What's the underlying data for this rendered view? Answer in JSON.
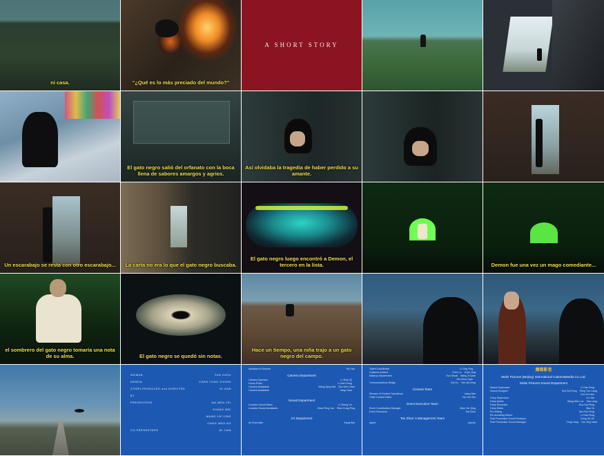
{
  "title_card": "A SHORT STORY",
  "subtitles": {
    "f1": "ni casa.",
    "f2": "“¿Qué es lo más preciado del mundo?”",
    "f7": "El gato negro salió del orfanato con la boca llena de sabores amargos y agrios.",
    "f8": "Así olvidaba la tragedia de haber perdido a su amante.",
    "f11": "Un escarabajo se resta con otro escarabajo...",
    "f12": "La carta no era lo que el gato negro buscaba.",
    "f13": "El gato negro luego encontró a Demon, el tercero en la lista.",
    "f15": "Demon fue una vez un mago comediante...",
    "f16": "el sombrero del gato negro tomaría una nota de su alma.",
    "f17": "El gato negro se quedó sin notas.",
    "f18": "Hace un tiempo, una niña trajo a un gato negro del campo."
  },
  "credits1": [
    [
      "WOMAN",
      "YAN ZHOU"
    ],
    [
      "DEMON",
      "CHEN YONG ZHONG"
    ],
    [
      "STORY,PRODUCED and DIRECTED BY",
      "BI GAN"
    ],
    [
      "PRESENTERS",
      "MA WEN YEI"
    ],
    [
      "",
      "ZHANG WEI"
    ],
    [
      "",
      "WANG JIE XING"
    ],
    [
      "",
      "JIANG WEN BO"
    ],
    [
      "CO-PRESENTERS",
      "BI JIAN"
    ]
  ],
  "credits2": {
    "top": [
      "Assistant to Director",
      "Wu Yao"
    ],
    "camera_heading": "Camera Department",
    "camera": [
      [
        "Camera Operator",
        "Li Zhao Qi",
        ""
      ],
      [
        "Focus Puller",
        "Li Wen Peng",
        ""
      ],
      [
        "Camera Assistants",
        "Wang Qing Wei",
        "Zhu Wen Zhan"
      ],
      [
        "Camera Assistants",
        "Yang Chao",
        ""
      ]
    ],
    "sound_heading": "Sound Department",
    "sound": [
      [
        "Location Sound Mixer",
        "Li Zheng Lin",
        ""
      ],
      [
        "Location Sound Assistants",
        "Zhao Peng Jun",
        "Shen Kang Ping"
      ]
    ],
    "art_heading": "Art Department",
    "art": [
      [
        "Art Executive",
        "Kang Wei"
      ]
    ]
  },
  "credits3": {
    "top": [
      [
        "Talent Coordinator",
        "Li Ying Ying",
        ""
      ],
      [
        "Costume Advisor",
        "Chen Lu",
        "Guan Jing"
      ],
      [
        "Makeup Department",
        "Sun Shuai",
        "Wang Xi Qian"
      ],
      [
        "",
        "Ma Shuo Yuan",
        ""
      ],
      [
        "Communications Bridge",
        "Cai Xu",
        "Yan Jia Dong"
      ]
    ],
    "content_heading": "Content Team",
    "content": [
      [
        "Director of Content Operations",
        "Liang Nan"
      ],
      [
        "Chief Content Editor",
        "Yao Xin Zhu"
      ]
    ],
    "event_heading": "Event Execution Team",
    "event": [
      [
        "Event Coordination Manager",
        "Miao Xin Qing"
      ],
      [
        "Event Execution",
        "Ma Zhuo"
      ]
    ],
    "mgmt_heading": "Tan Zhuo’ s Management Team",
    "mgmt": [
      [
        "Agent",
        "Jasmin"
      ]
    ]
  },
  "credits4": {
    "logo": "魔都影音",
    "company": "Mofei Pictures (Beijing) International Culture&Media Co.,Ltd.",
    "dept": "Mofei Pictures Sound Department",
    "rows": [
      [
        "Sound Supervisor",
        "Li Dan Feng",
        ""
      ],
      [
        "Sound Designer",
        "Sun Rui Feng",
        "Peng Yue Liang"
      ],
      [
        "",
        "Guo Hu Hen",
        ""
      ],
      [
        "Foley Supervisor",
        "Liu Yan",
        ""
      ],
      [
        "Foley Artists",
        "Wang Wen Lai",
        "Tian Lang"
      ],
      [
        "Foley Recordist",
        "Guo Kai Peng",
        ""
      ],
      [
        "Foley Editor",
        "Bao Yu",
        ""
      ],
      [
        "Pre-Mixing",
        "Sun Rui Feng",
        ""
      ],
      [
        "Re-recording Mixers",
        "Li Dan Feng",
        ""
      ],
      [
        "Post Production Sound Producer",
        "Gong Jin Jie",
        ""
      ],
      [
        "Post Production Sound Manager",
        "Yang Yang",
        "Yue Jing Xuan"
      ]
    ]
  }
}
